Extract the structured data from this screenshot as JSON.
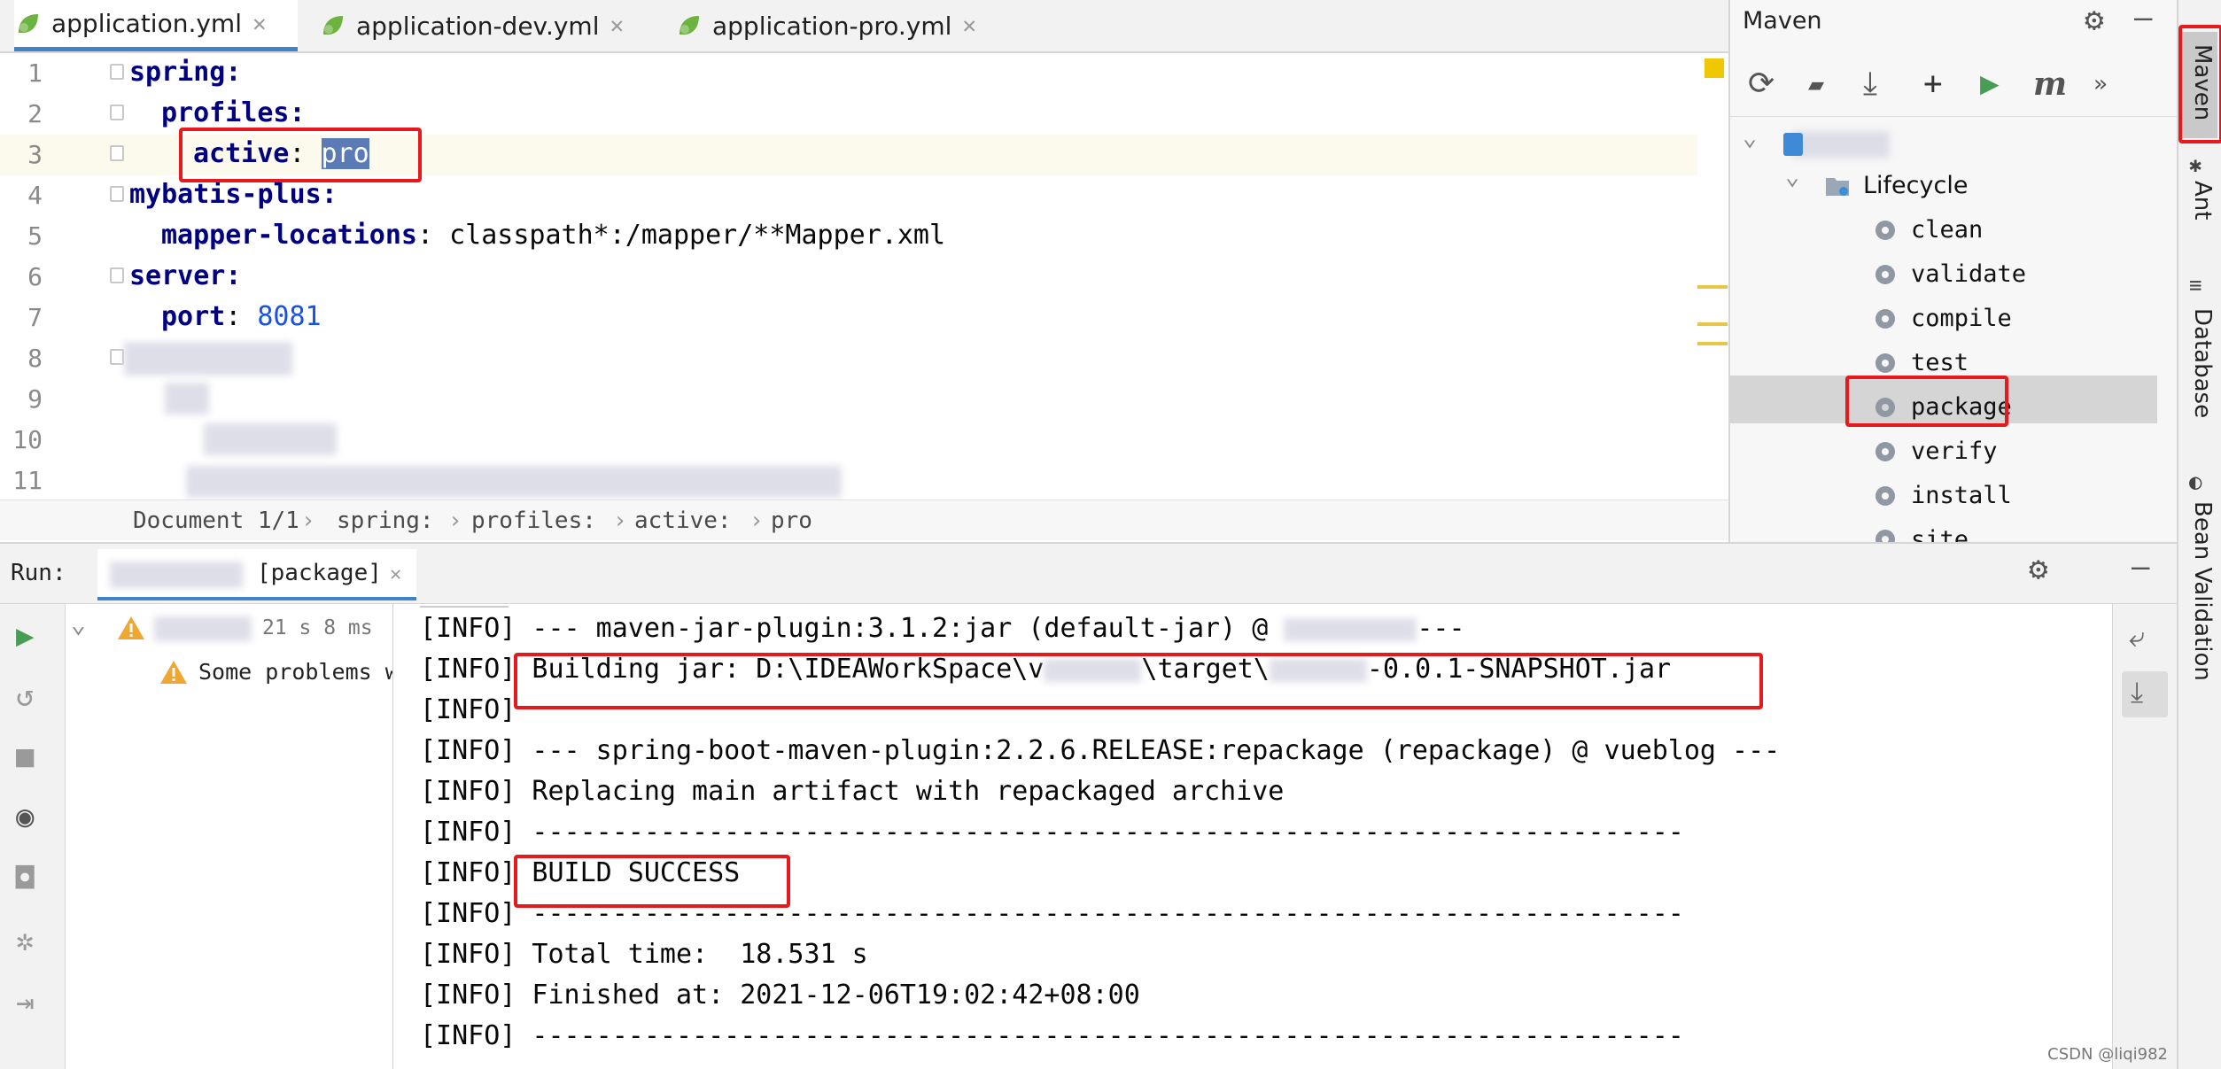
{
  "editor_tabs": [
    {
      "label": "application.yml",
      "active": true
    },
    {
      "label": "application-dev.yml",
      "active": false
    },
    {
      "label": "application-pro.yml",
      "active": false
    }
  ],
  "editor": {
    "line_numbers": [
      "1",
      "2",
      "3",
      "4",
      "5",
      "6",
      "7",
      "8",
      "9",
      "10",
      "11"
    ],
    "lines": [
      {
        "key": "spring",
        "sep": ":",
        "value": ""
      },
      {
        "key": "profiles",
        "sep": ":",
        "value": ""
      },
      {
        "key": "active",
        "sep": ": ",
        "value": "pro"
      },
      {
        "key": "mybatis-plus",
        "sep": ":",
        "value": ""
      },
      {
        "key": "mapper-locations",
        "sep": ": ",
        "value": "classpath*:/mapper/**Mapper.xml"
      },
      {
        "key": "server",
        "sep": ":",
        "value": ""
      },
      {
        "key": "port",
        "sep": ": ",
        "value": "8081"
      }
    ],
    "breadcrumb": [
      "Document 1/1",
      "spring:",
      "profiles:",
      "active:",
      "pro"
    ]
  },
  "maven": {
    "title": "Maven",
    "lifecycle_label": "Lifecycle",
    "goals": [
      "clean",
      "validate",
      "compile",
      "test",
      "package",
      "verify",
      "install",
      "site"
    ],
    "selected_goal": "package"
  },
  "side_tools": [
    "Maven",
    "Ant",
    "Database",
    "Bean Validation"
  ],
  "run": {
    "label": "Run:",
    "tab_label": "[package]",
    "tree_time": "21 s 8 ms",
    "tree_warning": "Some problems w",
    "console_lines": [
      "[INFO] --- maven-jar-plugin:3.1.2:jar (default-jar) @ ",
      "[INFO] Building jar: D:\\IDEAWorkSpace\\v",
      "[INFO]",
      "[INFO] --- spring-boot-maven-plugin:2.2.6.RELEASE:repackage (repackage) @ vueblog ---",
      "[INFO] Replacing main artifact with repackaged archive",
      "[INFO] ------------------------------------------------------------------------",
      "[INFO] BUILD SUCCESS",
      "[INFO] ------------------------------------------------------------------------",
      "[INFO] Total time:  18.531 s",
      "[INFO] Finished at: 2021-12-06T19:02:42+08:00",
      "[INFO] ------------------------------------------------------------------------"
    ],
    "jar_mid": "\\target\\",
    "jar_tail": "-0.0.1-SNAPSHOT.jar",
    "jar_plugin_tail": "---"
  },
  "watermark": "CSDN @liqi982",
  "colors": {
    "accent": "#4083c9",
    "highlight_box": "#e8191c",
    "run_green": "#499c54",
    "warning": "#f0a732"
  }
}
